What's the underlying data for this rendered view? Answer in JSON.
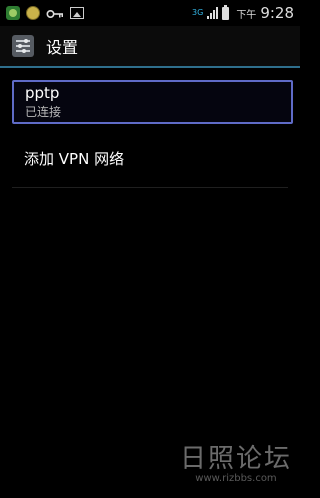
{
  "status_bar": {
    "network_type": "3G",
    "ampm": "下午",
    "time": "9:28",
    "icons": [
      "android-icon",
      "coin-icon",
      "key-icon",
      "image-icon",
      "signal-icon",
      "battery-icon"
    ]
  },
  "action_bar": {
    "title": "设置",
    "icon": "settings-sliders-icon"
  },
  "vpn_list": [
    {
      "name": "pptp",
      "status": "已连接"
    }
  ],
  "add_vpn_label": "添加 VPN 网络",
  "colors": {
    "background": "#000000",
    "accent_line": "#2f6f8d",
    "selected_border": "#5f6bc7",
    "network_blue": "#33b5e5"
  },
  "watermark": {
    "text": "日照论坛",
    "url": "www.rizbbs.com"
  }
}
